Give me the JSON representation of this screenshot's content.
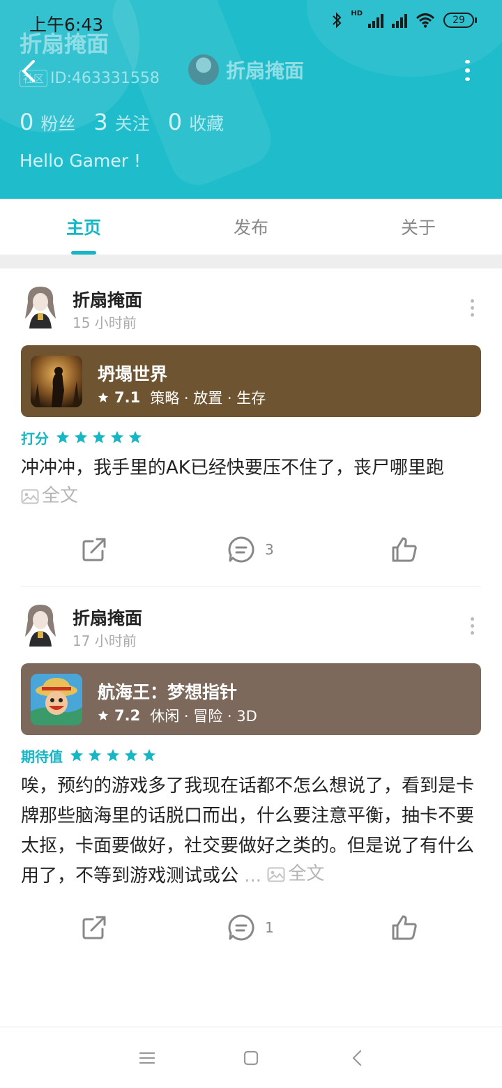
{
  "status_bar": {
    "time": "上午6:43",
    "hd_label": "HD",
    "battery": "29"
  },
  "profile": {
    "name": "折扇掩面",
    "id_badge": "社区",
    "id_text": "ID:463331558",
    "nav_name": "折扇掩面",
    "stats": [
      {
        "num": "0",
        "label": "粉丝"
      },
      {
        "num": "3",
        "label": "关注"
      },
      {
        "num": "0",
        "label": "收藏"
      }
    ],
    "bio": "Hello Gamer !"
  },
  "tabs": [
    {
      "label": "主页",
      "active": true
    },
    {
      "label": "发布",
      "active": false
    },
    {
      "label": "关于",
      "active": false
    }
  ],
  "posts": [
    {
      "author": "折扇掩面",
      "time": "15 小时前",
      "game": {
        "name": "坍塌世界",
        "score": "7.1",
        "tags": "策略 · 放置 · 生存",
        "card_color": "#6f5431"
      },
      "rating_label": "打分",
      "stars": 5,
      "text": "冲冲冲，我手里的AK已经快要压不住了，丧尸哪里跑",
      "ellipsis": "",
      "full_text_label": "全文",
      "comments": "3"
    },
    {
      "author": "折扇掩面",
      "time": "17 小时前",
      "game": {
        "name": "航海王：梦想指针",
        "score": "7.2",
        "tags": "休闲 · 冒险 · 3D",
        "card_color": "#7d695b"
      },
      "rating_label": "期待值",
      "stars": 5,
      "text": "唉，预约的游戏多了我现在话都不怎么想说了，看到是卡牌那些脑海里的话脱口而出，什么要注意平衡，抽卡不要太抠，卡面要做好，社交要做好之类的。但是说了有什么用了，不等到游戏测试或公",
      "ellipsis": "...",
      "full_text_label": "全文",
      "comments": "1"
    }
  ],
  "colors": {
    "accent": "#17b6c5",
    "header_bg": "#1fbccb"
  },
  "icons": {
    "nav": [
      "menu-icon",
      "home-square-icon",
      "back-triangle-icon"
    ],
    "post_actions": [
      "share-icon",
      "comment-icon",
      "like-icon"
    ]
  }
}
